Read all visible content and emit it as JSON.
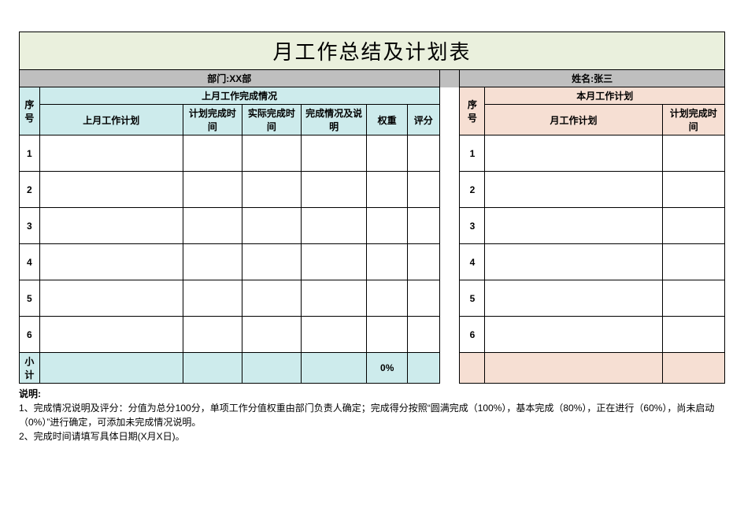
{
  "title": "月工作总结及计划表",
  "meta": {
    "dept_label": "部门:XX部",
    "name_label": "姓名:张三"
  },
  "headers": {
    "idx": "序号",
    "left_section": "上月工作完成情况",
    "right_section": "本月工作计划",
    "last_plan": "上月工作计划",
    "plan_done_time": "计划完成时间",
    "actual_done_time": "实际完成时间",
    "done_desc": "完成情况及说明",
    "weight": "权重",
    "score": "评分",
    "idx2": "序号",
    "month_plan": "月工作计划",
    "plan_done_time2": "计划完成时间"
  },
  "rows_left": [
    {
      "idx": "1",
      "plan": "",
      "plan_time": "",
      "actual_time": "",
      "desc": "",
      "weight": "",
      "score": ""
    },
    {
      "idx": "2",
      "plan": "",
      "plan_time": "",
      "actual_time": "",
      "desc": "",
      "weight": "",
      "score": ""
    },
    {
      "idx": "3",
      "plan": "",
      "plan_time": "",
      "actual_time": "",
      "desc": "",
      "weight": "",
      "score": ""
    },
    {
      "idx": "4",
      "plan": "",
      "plan_time": "",
      "actual_time": "",
      "desc": "",
      "weight": "",
      "score": ""
    },
    {
      "idx": "5",
      "plan": "",
      "plan_time": "",
      "actual_time": "",
      "desc": "",
      "weight": "",
      "score": ""
    },
    {
      "idx": "6",
      "plan": "",
      "plan_time": "",
      "actual_time": "",
      "desc": "",
      "weight": "",
      "score": ""
    }
  ],
  "rows_right": [
    {
      "idx": "1",
      "plan": "",
      "plan_time": ""
    },
    {
      "idx": "2",
      "plan": "",
      "plan_time": ""
    },
    {
      "idx": "3",
      "plan": "",
      "plan_time": ""
    },
    {
      "idx": "4",
      "plan": "",
      "plan_time": ""
    },
    {
      "idx": "5",
      "plan": "",
      "plan_time": ""
    },
    {
      "idx": "6",
      "plan": "",
      "plan_time": ""
    }
  ],
  "subtotal": {
    "label": "小计",
    "weight": "0%"
  },
  "notes": {
    "title": "说明:",
    "line1": "1、完成情况说明及评分：分值为总分100分，单项工作分值权重由部门负责人确定；完成得分按照“圆满完成（100%），基本完成（80%），正在进行（60%），尚未启动（0%）”进行确定，可添加未完成情况说明。",
    "line2": "2、完成时间请填写具体日期(X月X日)。"
  }
}
